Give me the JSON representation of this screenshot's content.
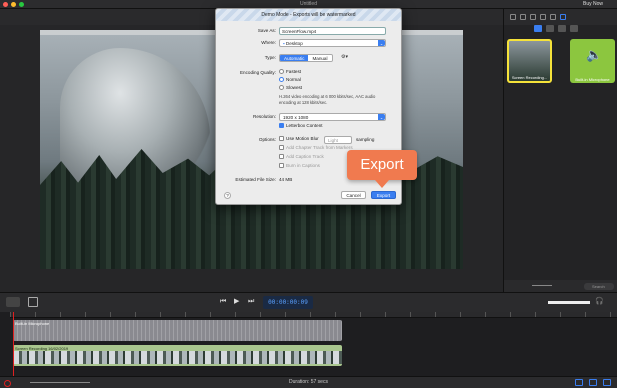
{
  "window": {
    "title": "Untitled",
    "buy_now": "Buy Now"
  },
  "dialog": {
    "title": "Demo Mode - Exports will be watermarked",
    "save_as_label": "Save As:",
    "save_as_value": "ScreenFlow.mp4",
    "where_label": "Where:",
    "where_value": "Desktop",
    "type_label": "Type:",
    "type_options": [
      "Automatic",
      "Manual"
    ],
    "type_selected": "Automatic",
    "quality_label": "Encoding Quality:",
    "quality_options": [
      "Fastest",
      "Normal",
      "Slowest"
    ],
    "quality_selected": "Normal",
    "quality_note": "H.264 video encoding at 6 000 kbits/sec, AAC audio encoding at 128 kbits/sec.",
    "resolution_label": "Resolution:",
    "resolution_value": "1920 x 1080",
    "letterbox_label": "Letterbox Content",
    "options_label": "Options:",
    "motion_blur_label": "Use Motion Blur",
    "motion_blur_level": "Light",
    "sampling_label": "sampling",
    "chapter_label": "Add Chapter Track from Markers",
    "caption_label": "Add Caption Track",
    "burn_label": "Burn in Captions",
    "filesize_label": "Estimated File Size:",
    "filesize_value": "44 MB",
    "help": "?",
    "cancel": "Cancel",
    "export": "Export"
  },
  "callout": "Export",
  "media": [
    {
      "name": "Screen Recording...",
      "selected": true
    },
    {
      "name": "Built-in Microphone",
      "selected": false
    }
  ],
  "inspector": {
    "search_placeholder": "Search"
  },
  "transport": {
    "timecode": "00:00:00:09"
  },
  "tracks": {
    "audio_label": "Built-in Microphone",
    "video_label": "Screen Recording 16/02/2019"
  },
  "footer": {
    "duration": "Duration: 57 secs"
  },
  "colors": {
    "accent": "#3a7ef0",
    "callout": "#f07a4f",
    "video_track": "#a9c68e",
    "audio_track": "#8a8a90",
    "media_selected_border": "#f5e23a"
  }
}
